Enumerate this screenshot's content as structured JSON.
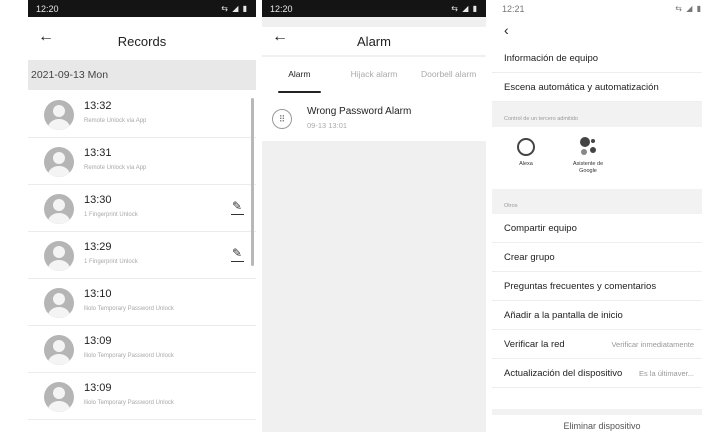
{
  "panel1": {
    "status": {
      "time": "12:20",
      "icons": "⇆ ◢ ▮"
    },
    "title": "Records",
    "date_header": "2021-09-13 Mon",
    "records": [
      {
        "time": "13:32",
        "desc": "Remote Unlock via App",
        "editable": false
      },
      {
        "time": "13:31",
        "desc": "Remote Unlock via App",
        "editable": false
      },
      {
        "time": "13:30",
        "desc": "1 Fingerprint Unlock",
        "editable": true
      },
      {
        "time": "13:29",
        "desc": "1 Fingerprint Unlock",
        "editable": true
      },
      {
        "time": "13:10",
        "desc": "lliolo  Temporary Password Unlock",
        "editable": false
      },
      {
        "time": "13:09",
        "desc": "lliolo  Temporary Password Unlock",
        "editable": false
      },
      {
        "time": "13:09",
        "desc": "lliolo  Temporary Password Unlock",
        "editable": false
      }
    ]
  },
  "panel2": {
    "status": {
      "time": "12:20",
      "icons": "⇆ ◢ ▮"
    },
    "title": "Alarm",
    "tabs": [
      {
        "label": "Alarm",
        "active": true
      },
      {
        "label": "Hijack alarm",
        "active": false
      },
      {
        "label": "Doorbell alarm",
        "active": false
      }
    ],
    "alarm": {
      "name": "Wrong Password Alarm",
      "time": "09-13 13:01"
    }
  },
  "panel3": {
    "status": {
      "time": "12:21",
      "icons": "⇆ ◢ ▮"
    },
    "rows_top": [
      {
        "label": "Información de equipo"
      },
      {
        "label": "Escena automática y automatización"
      }
    ],
    "section_third_party": "Control de un tercero admitido",
    "third_party": [
      {
        "label": "Alexa",
        "icon": "alexa-icon"
      },
      {
        "label": "Asistente de Google",
        "icon": "google-assistant-icon"
      }
    ],
    "section_others": "Otros",
    "rows_others": [
      {
        "label": "Compartir equipo",
        "value": ""
      },
      {
        "label": "Crear grupo",
        "value": ""
      },
      {
        "label": "Preguntas frecuentes y comentarios",
        "value": ""
      },
      {
        "label": "Añadir a la pantalla de inicio",
        "value": ""
      },
      {
        "label": "Verificar la red",
        "value": "Verificar inmediatamente"
      },
      {
        "label": "Actualización del dispositivo",
        "value": "Es la últimaver..."
      }
    ],
    "delete_label": "Eliminar dispositivo"
  }
}
